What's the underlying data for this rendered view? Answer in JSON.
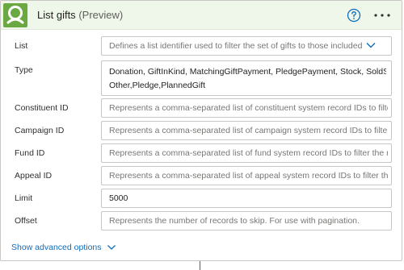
{
  "header": {
    "title": "List gifts",
    "badge": "(Preview)"
  },
  "fields": {
    "list": {
      "label": "List",
      "placeholder": "Defines a list identifier used to filter the set of gifts to those included in th"
    },
    "type": {
      "label": "Type",
      "lines": [
        "Donation, GiftInKind, MatchingGiftPayment, PledgePayment, Stock, SoldStock,",
        "Other,Pledge,PlannedGift"
      ]
    },
    "constituent_id": {
      "label": "Constituent ID",
      "placeholder": "Represents a comma-separated list of constituent system record IDs to filter the"
    },
    "campaign_id": {
      "label": "Campaign ID",
      "placeholder": "Represents a comma-separated list of campaign system record IDs to filter the r"
    },
    "fund_id": {
      "label": "Fund ID",
      "placeholder": "Represents a comma-separated list of fund system record IDs to filter the results"
    },
    "appeal_id": {
      "label": "Appeal ID",
      "placeholder": "Represents a comma-separated list of appeal system record IDs to filter the resu"
    },
    "limit": {
      "label": "Limit",
      "value": "5000"
    },
    "offset": {
      "label": "Offset",
      "placeholder": "Represents the number of records to skip. For use with pagination."
    }
  },
  "footer": {
    "advanced_label": "Show advanced options"
  },
  "icons": {
    "app": "connector-app-icon",
    "help": "help-circle-icon",
    "more": "more-horizontal-icon",
    "dropdown": "chevron-down-icon"
  },
  "colors": {
    "header_bg": "#eef7ea",
    "app_icon_bg": "#6aa842",
    "accent": "#0f6cbd",
    "border": "#c8c6c4"
  }
}
